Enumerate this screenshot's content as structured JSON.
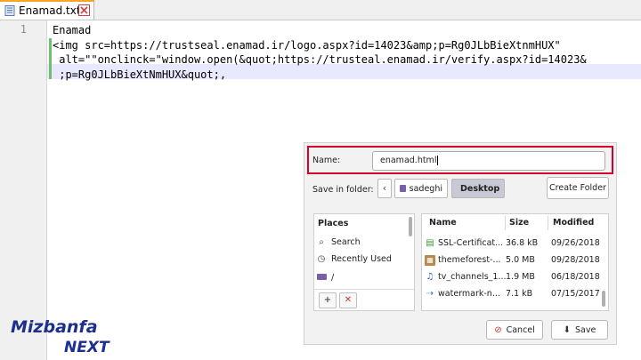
{
  "tab": {
    "title": "Enamad.txt",
    "close_icon": "close-icon"
  },
  "editor": {
    "line_number": "1",
    "lines": [
      "Enamad",
      "<img src=https://trustseal.enamad.ir/logo.aspx?id=14023&amp;p=Rg0JLbBieXtnmHUX\"",
      " alt=\"\"onclinck=\"window.open(&quot;https://trusteal.enamad.ir/verify.aspx?id=14023&",
      " ;p=Rg0JLbBieXtNmHUX&quot;,"
    ]
  },
  "dialog": {
    "name_label": "Name:",
    "name_value": "enamad.html",
    "save_in_label": "Save in folder:",
    "crumbs": [
      "sadeghi",
      "Desktop"
    ],
    "create_folder": "Create Folder",
    "places_header": "Places",
    "places": [
      "Search",
      "Recently Used",
      "/"
    ],
    "columns": {
      "name": "Name",
      "size": "Size",
      "modified": "Modified"
    },
    "files": [
      {
        "name": "SSL-Certificat...",
        "size": "36.8 kB",
        "modified": "09/26/2018"
      },
      {
        "name": "themeforest-...",
        "size": "5.0 MB",
        "modified": "09/28/2018"
      },
      {
        "name": "tv_channels_1...",
        "size": "1.9 MB",
        "modified": "06/18/2018"
      },
      {
        "name": "watermark-n...",
        "size": "7.1 kB",
        "modified": "07/15/2017"
      }
    ],
    "cancel_label": "Cancel",
    "save_label": "Save"
  },
  "logo": {
    "line1": "Mizbanfa",
    "line2": "NEXT"
  },
  "colors": {
    "highlight_border": "#d6002a",
    "change_marker": "#6ec06e",
    "logo_blue": "#1c2f8c"
  }
}
